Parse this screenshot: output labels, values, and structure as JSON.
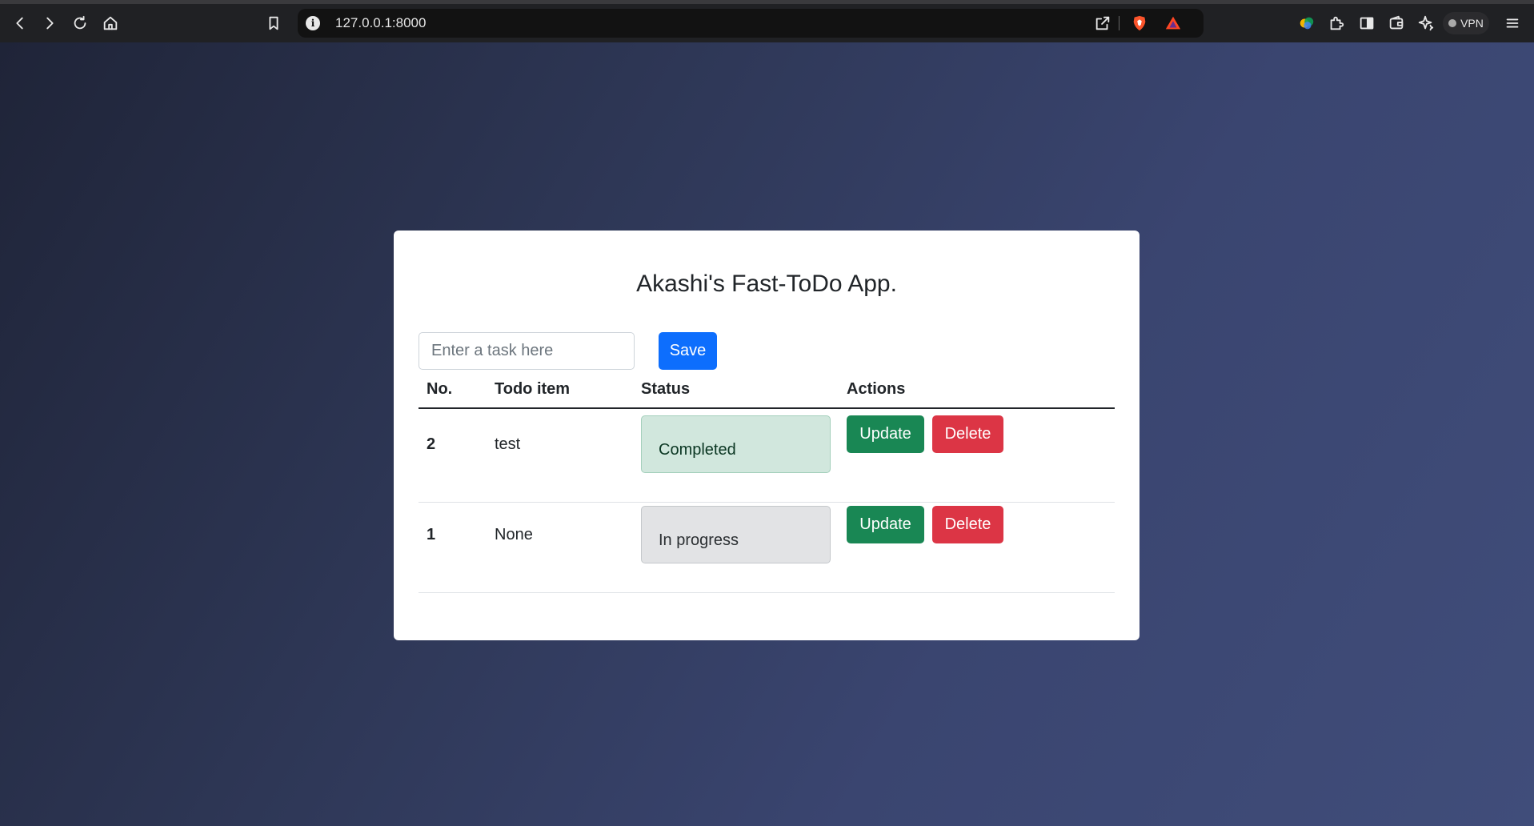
{
  "browser": {
    "url": "127.0.0.1:8000",
    "vpn_label": "VPN"
  },
  "app": {
    "title": "Akashi's Fast-ToDo App.",
    "input_placeholder": "Enter a task here",
    "save_label": "Save",
    "columns": [
      "No.",
      "Todo item",
      "Status",
      "Actions"
    ],
    "rows": [
      {
        "no": "2",
        "item": "test",
        "status": "Completed",
        "update_label": "Update",
        "delete_label": "Delete"
      },
      {
        "no": "1",
        "item": "None",
        "status": "In progress",
        "update_label": "Update",
        "delete_label": "Delete"
      }
    ]
  },
  "colors": {
    "primary": "#0d6efd",
    "success": "#198754",
    "danger": "#dc3545",
    "status_completed_bg": "#d1e7dd",
    "status_in_progress_bg": "#e2e3e5"
  }
}
